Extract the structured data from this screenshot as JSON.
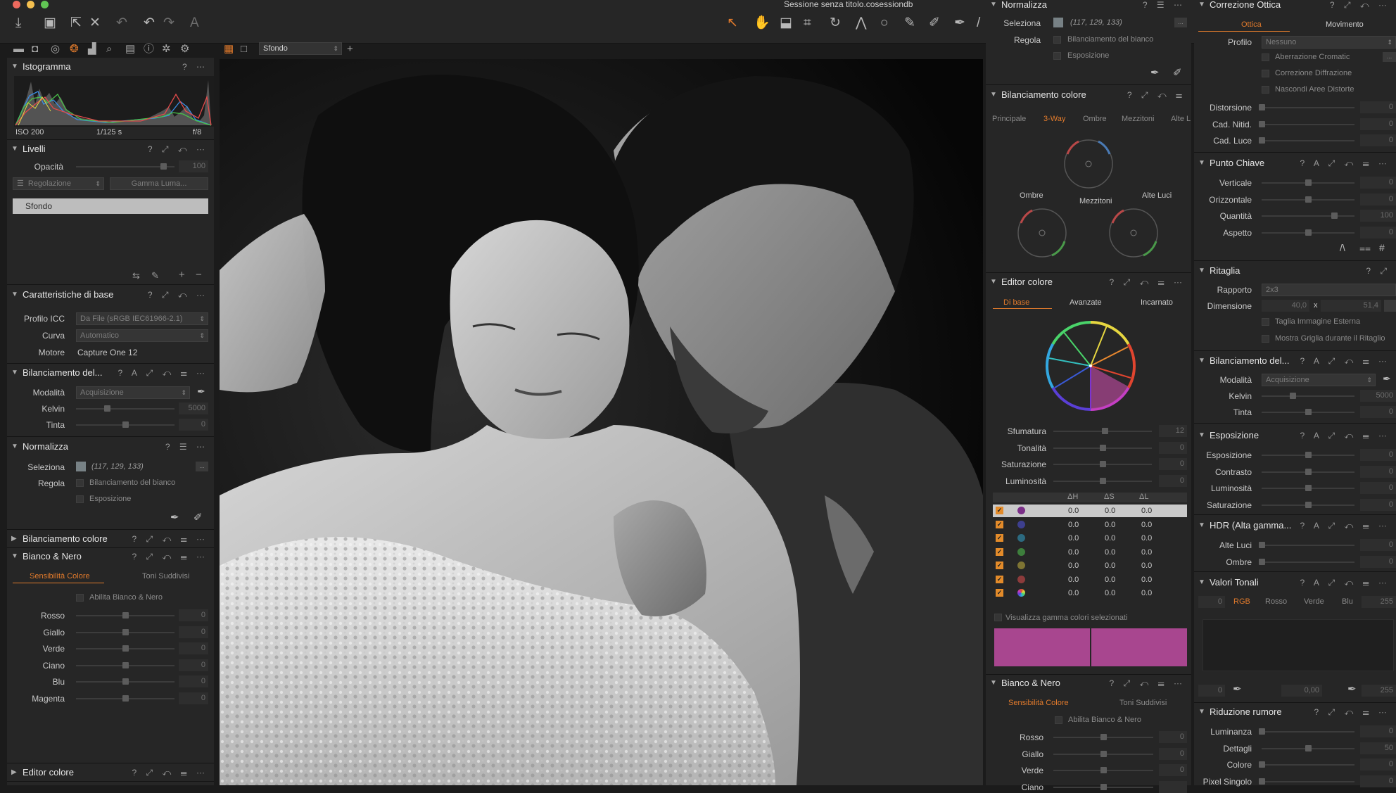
{
  "window": {
    "title": "Sessione senza titolo.cosessiondb"
  },
  "colors": {
    "accent": "#e07a2c",
    "panel": "#262626",
    "magenta_swatch": "#a8468f"
  },
  "viewer": {
    "layer_select": "Sfondo"
  },
  "left": {
    "histogram": {
      "title": "Istogramma",
      "iso": "ISO 200",
      "shutter": "1/125 s",
      "aperture": "f/8"
    },
    "levels": {
      "title": "Livelli",
      "opacity_label": "Opacità",
      "opacity_value": "100",
      "adjust_label": "Regolazione",
      "gamma_label": "Gamma Luma...",
      "layer": "Sfondo"
    },
    "base": {
      "title": "Caratteristiche di base",
      "icc_label": "Profilo ICC",
      "icc_value": "Da File (sRGB IEC61966-2.1)",
      "curve_label": "Curva",
      "curve_value": "Automatico",
      "engine_label": "Motore",
      "engine_value": "Capture One 12"
    },
    "wb": {
      "title": "Bilanciamento del...",
      "mode_label": "Modalità",
      "mode_value": "Acquisizione",
      "kelvin_label": "Kelvin",
      "kelvin_value": "5000",
      "tint_label": "Tinta",
      "tint_value": "0"
    },
    "norm": {
      "title": "Normalizza",
      "select_label": "Seleziona",
      "select_value": "(117, 129, 133)",
      "adjust_label": "Regola",
      "wb_label": "Bilanciamento del bianco",
      "exp_label": "Esposizione"
    },
    "cb": {
      "title": "Bilanciamento colore"
    },
    "bw": {
      "title": "Bianco & Nero",
      "tab1": "Sensibilità Colore",
      "tab2": "Toni Suddivisi",
      "enable": "Abilita Bianco & Nero",
      "rows": [
        {
          "label": "Rosso",
          "value": "0"
        },
        {
          "label": "Giallo",
          "value": "0"
        },
        {
          "label": "Verde",
          "value": "0"
        },
        {
          "label": "Ciano",
          "value": "0"
        },
        {
          "label": "Blu",
          "value": "0"
        },
        {
          "label": "Magenta",
          "value": "0"
        }
      ]
    },
    "ce": {
      "title": "Editor colore"
    }
  },
  "mid": {
    "norm": {
      "title": "Normalizza",
      "select_label": "Seleziona",
      "select_value": "(117, 129, 133)",
      "adjust_label": "Regola",
      "wb_label": "Bilanciamento del bianco",
      "exp_label": "Esposizione"
    },
    "cb": {
      "title": "Bilanciamento colore",
      "tabs": [
        "Principale",
        "3-Way",
        "Ombre",
        "Mezzitoni",
        "Alte L"
      ],
      "shadows": "Ombre",
      "mids": "Mezzitoni",
      "highs": "Alte Luci"
    },
    "ce": {
      "title": "Editor colore",
      "tab1": "Di base",
      "tab2": "Avanzate",
      "tab3": "Incarnato",
      "sliders": [
        {
          "label": "Sfumatura",
          "value": "12"
        },
        {
          "label": "Tonalità",
          "value": "0"
        },
        {
          "label": "Saturazione",
          "value": "0"
        },
        {
          "label": "Luminosità",
          "value": "0"
        }
      ],
      "cols": [
        "ΔH",
        "ΔS",
        "ΔL"
      ],
      "rows": [
        {
          "color": "#7b2f88",
          "h": "0.0",
          "s": "0.0",
          "l": "0.0"
        },
        {
          "color": "#3d3f8e",
          "h": "0.0",
          "s": "0.0",
          "l": "0.0"
        },
        {
          "color": "#2c6a80",
          "h": "0.0",
          "s": "0.0",
          "l": "0.0"
        },
        {
          "color": "#3d7e3c",
          "h": "0.0",
          "s": "0.0",
          "l": "0.0"
        },
        {
          "color": "#7e7433",
          "h": "0.0",
          "s": "0.0",
          "l": "0.0"
        },
        {
          "color": "#8c3b3b",
          "h": "0.0",
          "s": "0.0",
          "l": "0.0"
        },
        {
          "color": "rainbow",
          "h": "0.0",
          "s": "0.0",
          "l": "0.0"
        }
      ],
      "show_gamut": "Visualizza gamma colori selezionati"
    },
    "bw": {
      "title": "Bianco & Nero",
      "tab1": "Sensibilità Colore",
      "tab2": "Toni Suddivisi",
      "enable": "Abilita Bianco & Nero",
      "rows": [
        {
          "label": "Rosso",
          "value": "0"
        },
        {
          "label": "Giallo",
          "value": "0"
        },
        {
          "label": "Verde",
          "value": "0"
        },
        {
          "label": "Ciano",
          "value": ""
        }
      ]
    }
  },
  "right": {
    "optics": {
      "title": "Correzione Ottica",
      "tab1": "Ottica",
      "tab2": "Movimento",
      "profile_label": "Profilo",
      "profile_value": "Nessuno",
      "chk1": "Aberrazione Cromatic",
      "chk2": "Correzione Diffrazione",
      "chk3": "Nascondi Aree Distorte",
      "sliders": [
        {
          "label": "Distorsione",
          "value": "0"
        },
        {
          "label": "Cad. Nitid.",
          "value": "0"
        },
        {
          "label": "Cad. Luce",
          "value": "0"
        }
      ]
    },
    "keystone": {
      "title": "Punto Chiave",
      "sliders": [
        {
          "label": "Verticale",
          "value": "0"
        },
        {
          "label": "Orizzontale",
          "value": "0"
        },
        {
          "label": "Quantità",
          "value": "100"
        },
        {
          "label": "Aspetto",
          "value": "0"
        }
      ]
    },
    "crop": {
      "title": "Ritaglia",
      "ratio_label": "Rapporto",
      "ratio_value": "2x3",
      "size_label": "Dimensione",
      "w": "40,0",
      "h": "51,4",
      "x": "x",
      "chk1": "Taglia Immagine Esterna",
      "chk2": "Mostra Griglia durante il Ritaglio"
    },
    "wb": {
      "title": "Bilanciamento del...",
      "mode_label": "Modalità",
      "mode_value": "Acquisizione",
      "kelvin_label": "Kelvin",
      "kelvin_value": "5000",
      "tint_label": "Tinta",
      "tint_value": "0"
    },
    "exposure": {
      "title": "Esposizione",
      "sliders": [
        {
          "label": "Esposizione",
          "value": "0"
        },
        {
          "label": "Contrasto",
          "value": "0"
        },
        {
          "label": "Luminosità",
          "value": "0"
        },
        {
          "label": "Saturazione",
          "value": "0"
        }
      ]
    },
    "hdr": {
      "title": "HDR (Alta gamma...",
      "sliders": [
        {
          "label": "Alte Luci",
          "value": "0"
        },
        {
          "label": "Ombre",
          "value": "0"
        }
      ]
    },
    "levels": {
      "title": "Valori Tonali",
      "in_left": "0",
      "tabs": [
        "RGB",
        "Rosso",
        "Verde",
        "Blu"
      ],
      "in_right": "255",
      "out_left": "0",
      "mid": "0,00",
      "out_right": "255"
    },
    "noise": {
      "title": "Riduzione rumore",
      "sliders": [
        {
          "label": "Luminanza",
          "value": "0"
        },
        {
          "label": "Dettagli",
          "value": "50"
        },
        {
          "label": "Colore",
          "value": "0"
        },
        {
          "label": "Pixel Singolo",
          "value": "0"
        }
      ]
    }
  }
}
